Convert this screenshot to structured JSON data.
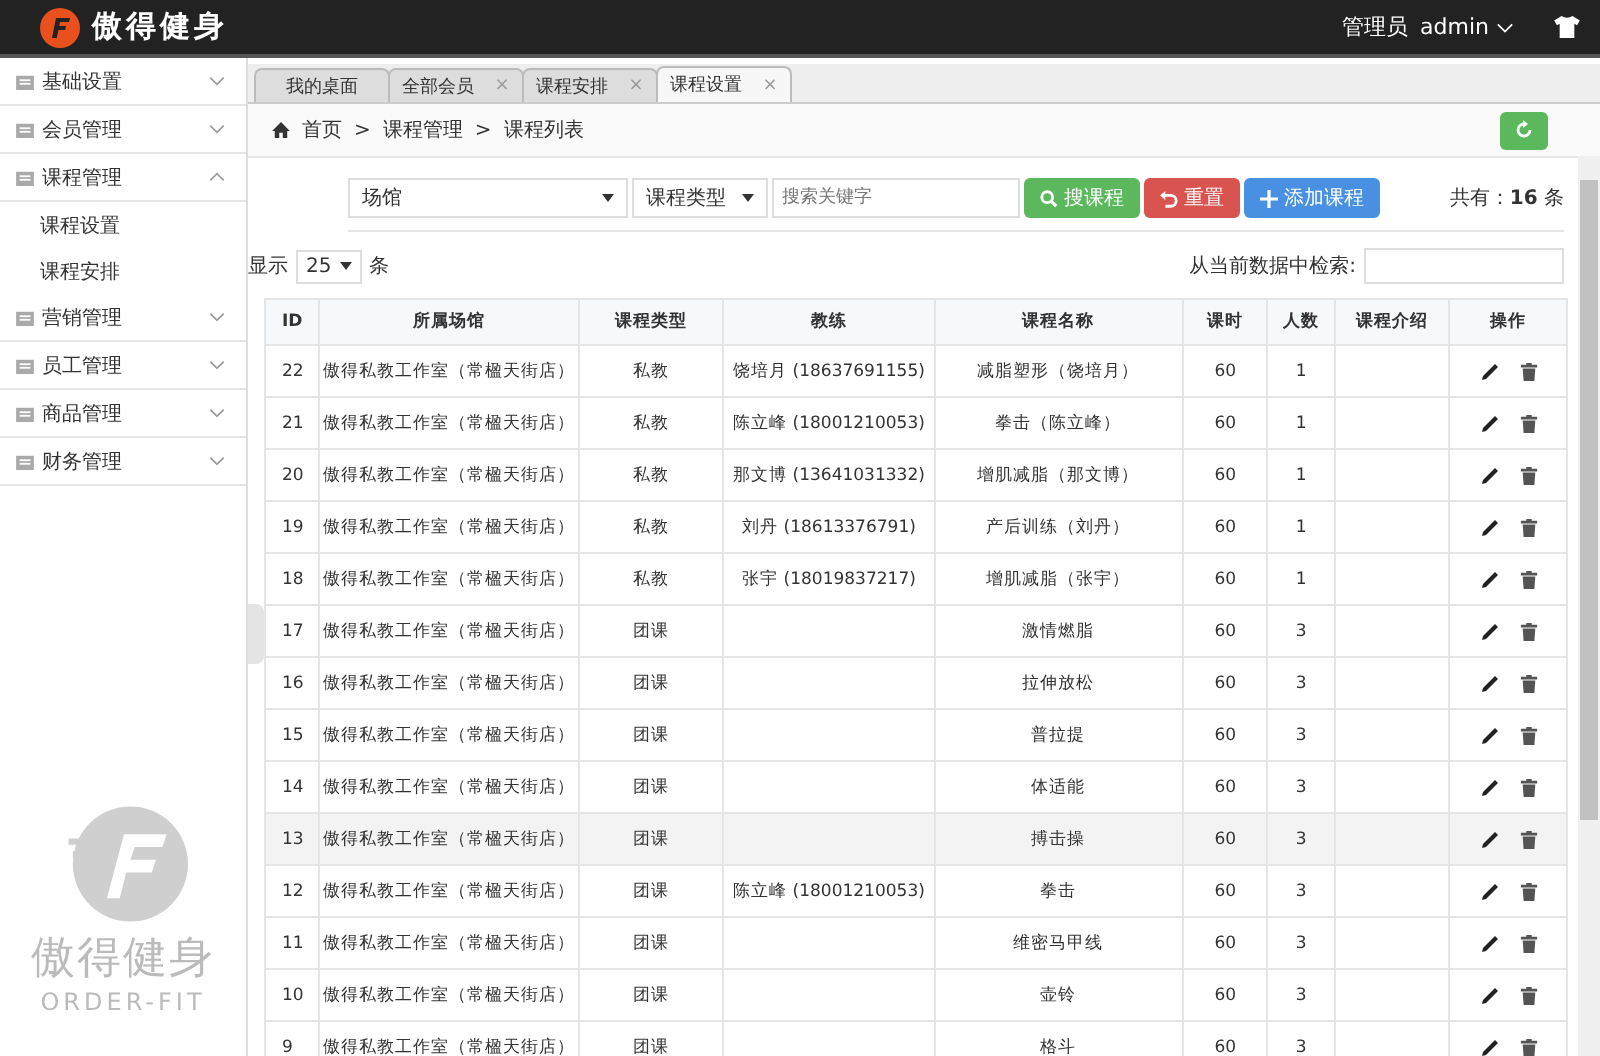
{
  "header": {
    "brand": "傲得健身",
    "role": "管理员",
    "user": "admin"
  },
  "sidebar": {
    "items": [
      {
        "label": "基础设置",
        "expanded": false
      },
      {
        "label": "会员管理",
        "expanded": false
      },
      {
        "label": "课程管理",
        "expanded": true,
        "children": [
          {
            "label": "课程设置"
          },
          {
            "label": "课程安排"
          }
        ]
      },
      {
        "label": "营销管理",
        "expanded": false
      },
      {
        "label": "员工管理",
        "expanded": false
      },
      {
        "label": "商品管理",
        "expanded": false
      },
      {
        "label": "财务管理",
        "expanded": false
      }
    ],
    "logo_text": "傲得健身",
    "logo_subtext": "ORDER-FIT"
  },
  "tabs": [
    {
      "label": "我的桌面",
      "closable": false,
      "selected": false
    },
    {
      "label": "全部会员",
      "closable": true,
      "selected": false
    },
    {
      "label": "课程安排",
      "closable": true,
      "selected": false
    },
    {
      "label": "课程设置",
      "closable": true,
      "selected": true
    }
  ],
  "close_glyph": "×",
  "breadcrumb": [
    "首页",
    "课程管理",
    "课程列表"
  ],
  "breadcrumb_sep": ">",
  "filters": {
    "venue": "场馆",
    "type": "课程类型",
    "search_placeholder": "搜索关键字"
  },
  "buttons": [
    {
      "label": "搜课程",
      "kind": "search"
    },
    {
      "label": "重置",
      "kind": "reset"
    },
    {
      "label": "添加课程",
      "kind": "add"
    }
  ],
  "total": {
    "label": "共有：",
    "count": "16",
    "unit": "条"
  },
  "page_size": {
    "prefix": "显示",
    "value": "25",
    "suffix": "条"
  },
  "filter_label": "从当前数据中检索:",
  "table": {
    "columns": [
      "ID",
      "所属场馆",
      "课程类型",
      "教练",
      "课程名称",
      "课时",
      "人数",
      "课程介绍",
      "操作"
    ],
    "rows": [
      {
        "id": "22",
        "venue": "傲得私教工作室（常楹天街店）",
        "type": "私教",
        "coach": "饶培月 (18637691155)",
        "name": "减脂塑形（饶培月）",
        "hours": "60",
        "people": "1",
        "selected": false
      },
      {
        "id": "21",
        "venue": "傲得私教工作室（常楹天街店）",
        "type": "私教",
        "coach": "陈立峰 (18001210053)",
        "name": "拳击（陈立峰）",
        "hours": "60",
        "people": "1",
        "selected": false
      },
      {
        "id": "20",
        "venue": "傲得私教工作室（常楹天街店）",
        "type": "私教",
        "coach": "那文博 (13641031332)",
        "name": "增肌减脂（那文博）",
        "hours": "60",
        "people": "1",
        "selected": false
      },
      {
        "id": "19",
        "venue": "傲得私教工作室（常楹天街店）",
        "type": "私教",
        "coach": "刘丹 (18613376791)",
        "name": "产后训练（刘丹）",
        "hours": "60",
        "people": "1",
        "selected": false
      },
      {
        "id": "18",
        "venue": "傲得私教工作室（常楹天街店）",
        "type": "私教",
        "coach": "张宇 (18019837217)",
        "name": "增肌减脂（张宇）",
        "hours": "60",
        "people": "1",
        "selected": false
      },
      {
        "id": "17",
        "venue": "傲得私教工作室（常楹天街店）",
        "type": "团课",
        "coach": "",
        "name": "激情燃脂",
        "hours": "60",
        "people": "3",
        "selected": false
      },
      {
        "id": "16",
        "venue": "傲得私教工作室（常楹天街店）",
        "type": "团课",
        "coach": "",
        "name": "拉伸放松",
        "hours": "60",
        "people": "3",
        "selected": false
      },
      {
        "id": "15",
        "venue": "傲得私教工作室（常楹天街店）",
        "type": "团课",
        "coach": "",
        "name": "普拉提",
        "hours": "60",
        "people": "3",
        "selected": false
      },
      {
        "id": "14",
        "venue": "傲得私教工作室（常楹天街店）",
        "type": "团课",
        "coach": "",
        "name": "体适能",
        "hours": "60",
        "people": "3",
        "selected": false
      },
      {
        "id": "13",
        "venue": "傲得私教工作室（常楹天街店）",
        "type": "团课",
        "coach": "",
        "name": "搏击操",
        "hours": "60",
        "people": "3",
        "selected": true
      },
      {
        "id": "12",
        "venue": "傲得私教工作室（常楹天街店）",
        "type": "团课",
        "coach": "陈立峰 (18001210053)",
        "name": "拳击",
        "hours": "60",
        "people": "3",
        "selected": false
      },
      {
        "id": "11",
        "venue": "傲得私教工作室（常楹天街店）",
        "type": "团课",
        "coach": "",
        "name": "维密马甲线",
        "hours": "60",
        "people": "3",
        "selected": false
      },
      {
        "id": "10",
        "venue": "傲得私教工作室（常楹天街店）",
        "type": "团课",
        "coach": "",
        "name": "壶铃",
        "hours": "60",
        "people": "3",
        "selected": false
      },
      {
        "id": "9",
        "venue": "傲得私教工作室（常楹天街店）",
        "type": "团课",
        "coach": "",
        "name": "格斗",
        "hours": "60",
        "people": "3",
        "selected": false
      }
    ]
  }
}
